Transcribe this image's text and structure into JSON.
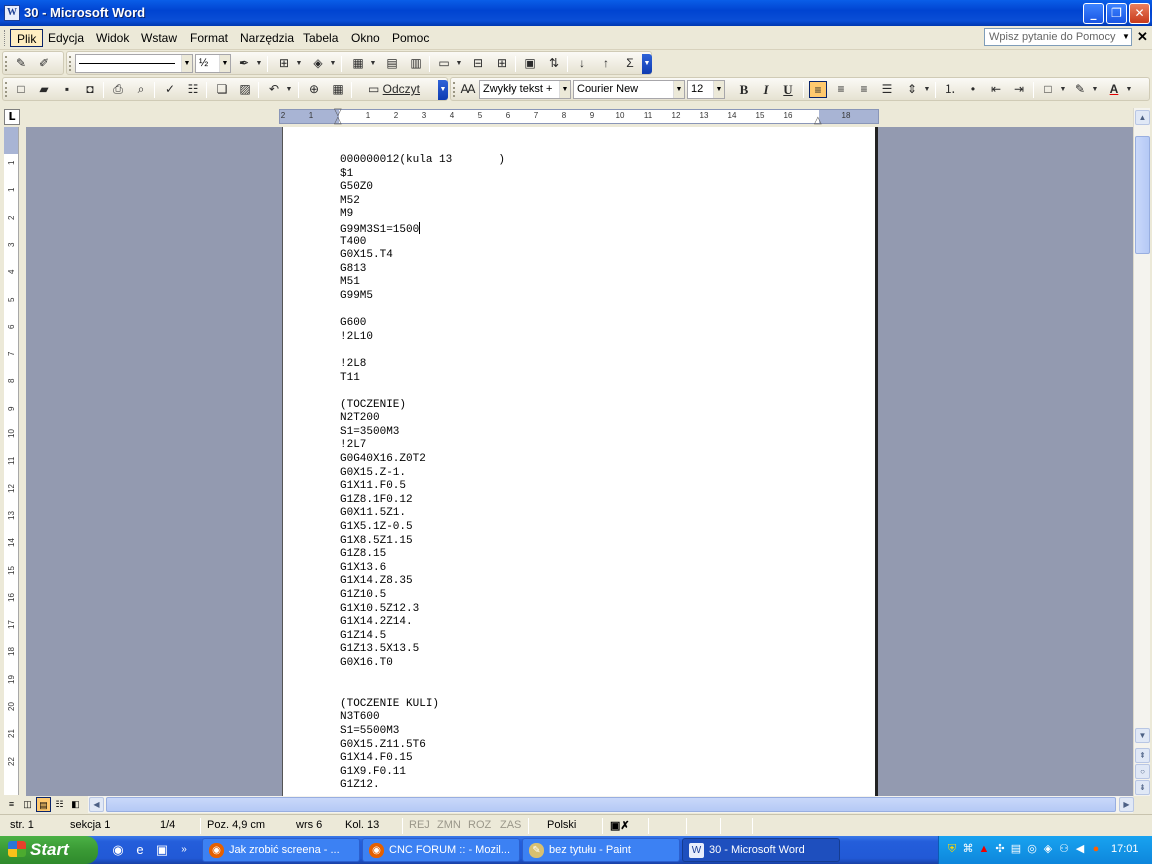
{
  "window": {
    "title": "30 - Microsoft Word",
    "icon_letter": "W"
  },
  "menu": {
    "items": [
      "Plik",
      "Edycja",
      "Widok",
      "Wstaw",
      "Format",
      "Narzędzia",
      "Tabela",
      "Okno",
      "Pomoc"
    ],
    "help_placeholder": "Wpisz pytanie do Pomocy"
  },
  "toolbar_drawing": {
    "line_width": "½"
  },
  "toolbar_formatting": {
    "style": "Zwykły tekst +",
    "font": "Courier New",
    "size": "12",
    "bold": "B",
    "italic": "I",
    "underline": "U",
    "read_label": "Odczyt"
  },
  "ruler": {
    "labels": [
      "2",
      "1",
      "1",
      "2",
      "3",
      "4",
      "5",
      "6",
      "7",
      "8",
      "9",
      "10",
      "11",
      "12",
      "13",
      "14",
      "15",
      "16",
      "18"
    ],
    "vlabels": [
      "1",
      "1",
      "2",
      "3",
      "4",
      "5",
      "6",
      "7",
      "8",
      "9",
      "10",
      "11",
      "12",
      "13",
      "14",
      "15",
      "16",
      "17",
      "18",
      "19",
      "20",
      "21",
      "22"
    ]
  },
  "document": {
    "lines": [
      "000000012(kula 13       )",
      "$1",
      "G50Z0",
      "M52",
      "M9",
      "G99M3S1=1500",
      "T400",
      "G0X15.T4",
      "G813",
      "M51",
      "G99M5",
      "",
      "G600",
      "!2L10",
      "",
      "!2L8",
      "T11",
      "",
      "(TOCZENIE)",
      "N2T200",
      "S1=3500M3",
      "!2L7",
      "G0G40X16.Z0T2",
      "G0X15.Z-1.",
      "G1X11.F0.5",
      "G1Z8.1F0.12",
      "G0X11.5Z1.",
      "G1X5.1Z-0.5",
      "G1X8.5Z1.15",
      "G1Z8.15",
      "G1X13.6",
      "G1X14.Z8.35",
      "G1Z10.5",
      "G1X10.5Z12.3",
      "G1X14.2Z14.",
      "G1Z14.5",
      "G1Z13.5X13.5",
      "G0X16.T0",
      "",
      "",
      "(TOCZENIE KULI)",
      "N3T600",
      "S1=5500M3",
      "G0X15.Z11.5T6",
      "G1X14.F0.15",
      "G1X9.F0.11",
      "G1Z12."
    ]
  },
  "status": {
    "page": "str. 1",
    "section": "sekcja 1",
    "pages": "1/4",
    "position": "Poz. 4,9 cm",
    "line": "wrs 6",
    "column": "Kol. 13",
    "rec": "REJ",
    "trk": "ZMN",
    "ext": "ROZ",
    "ovr": "ZAS",
    "language": "Polski"
  },
  "taskbar": {
    "start": "Start",
    "tasks": [
      {
        "label": "Jak zrobić screena - ...",
        "active": false
      },
      {
        "label": "CNC FORUM :: - Mozil...",
        "active": false
      },
      {
        "label": "bez tytułu - Paint",
        "active": false
      },
      {
        "label": "30 - Microsoft Word",
        "active": true
      }
    ],
    "clock": "17:01"
  }
}
